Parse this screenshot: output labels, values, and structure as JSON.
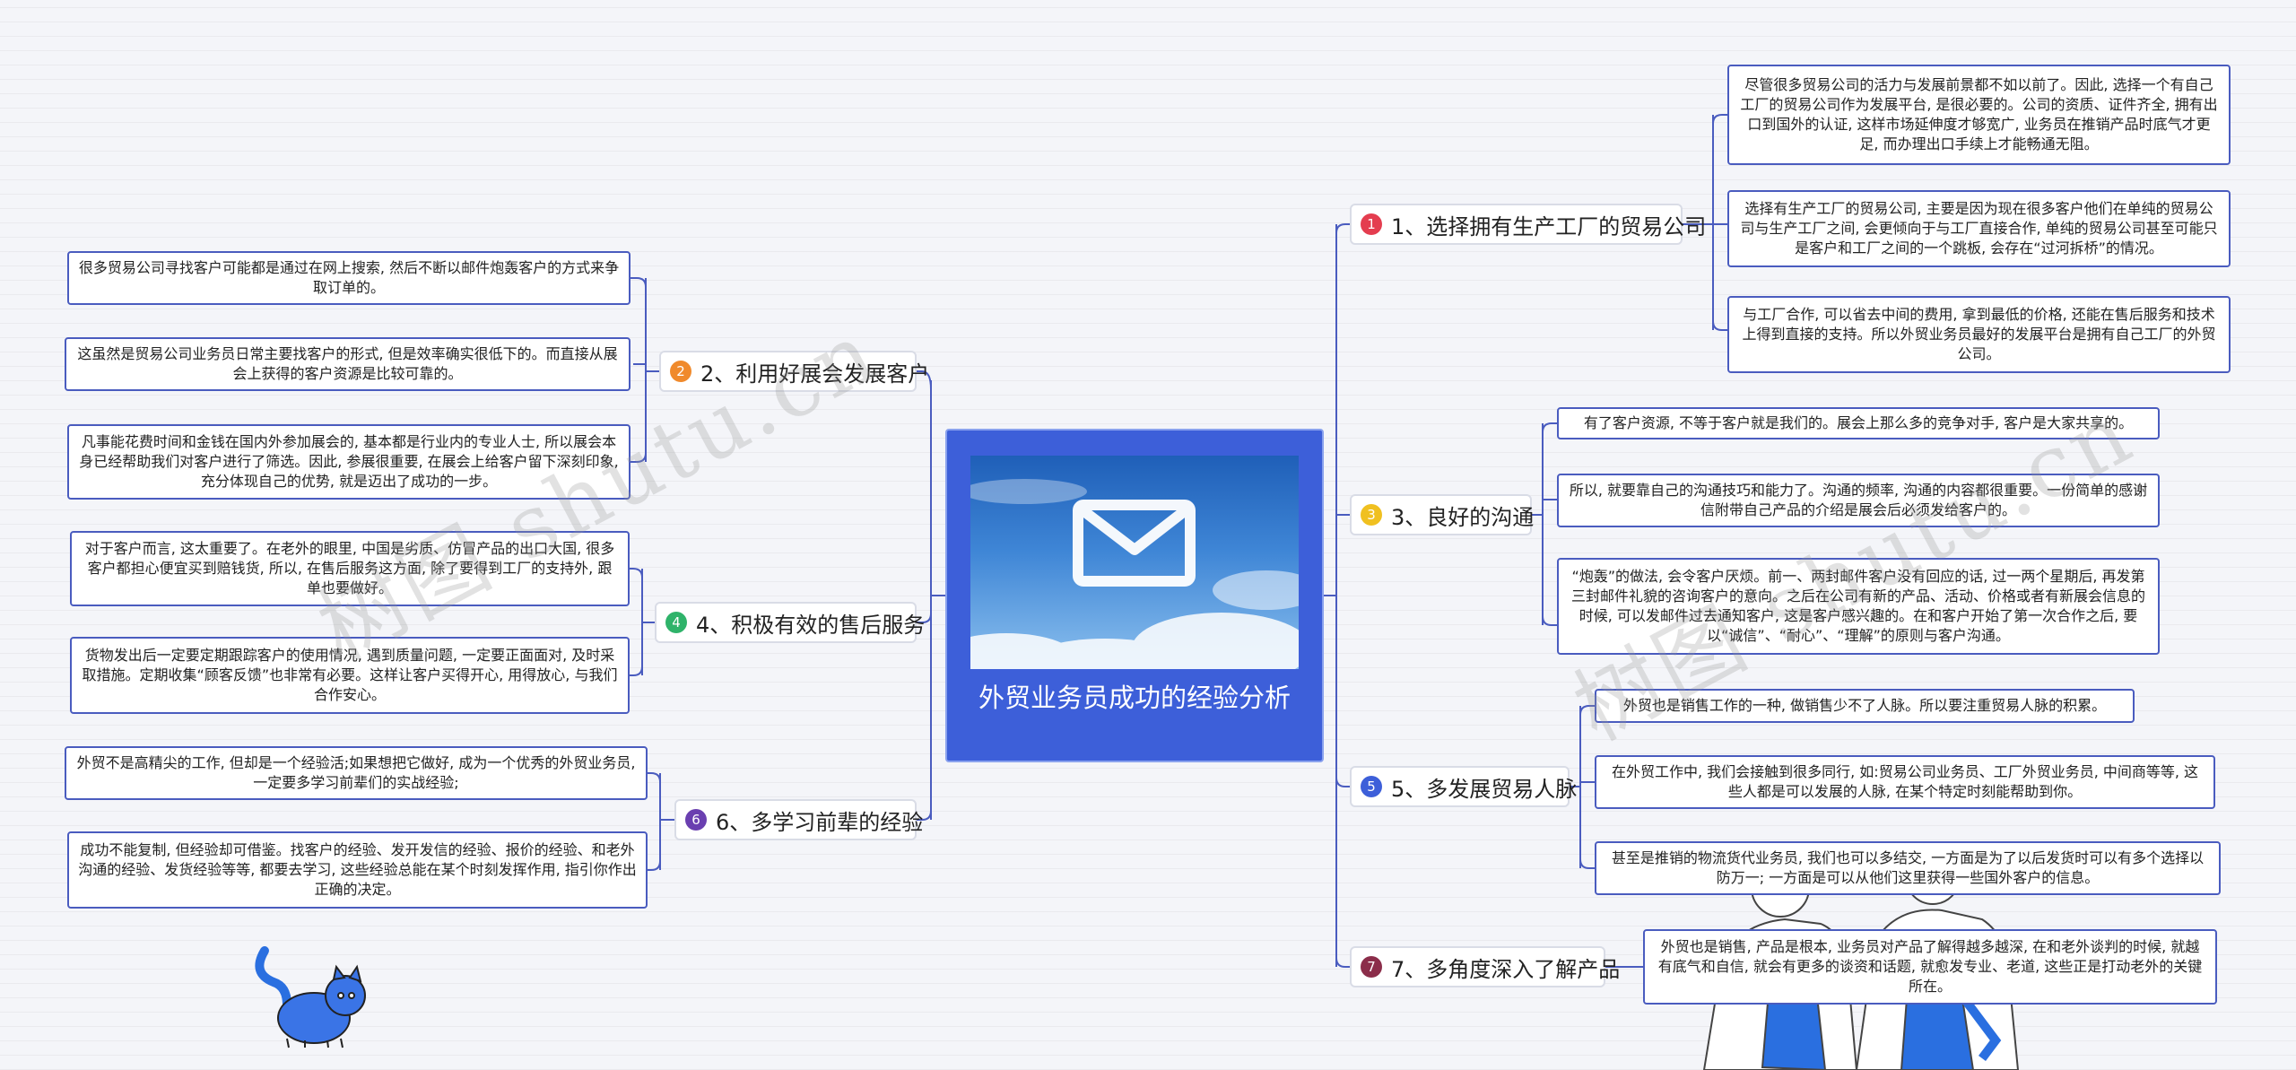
{
  "watermarks": [
    "树图 shutu.cn",
    "树图 shutu.cn"
  ],
  "center": {
    "title": "外贸业务员成功的经验分析",
    "image_icon": "envelope-cloud-icon"
  },
  "colors": {
    "center_bg": "#3d5fd9",
    "leaf_border": "#4a5cbf",
    "line": "#4a5cbf"
  },
  "branches": [
    {
      "badge": "1",
      "color": "#e43d4f",
      "label": "1、选择拥有生产工厂的贸易公司",
      "leaves": [
        "尽管很多贸易公司的活力与发展前景都不如以前了。因此, 选择一个有自己工厂的贸易公司作为发展平台, 是很必要的。公司的资质、证件齐全, 拥有出口到国外的认证, 这样市场延伸度才够宽广, 业务员在推销产品时底气才更足, 而办理出口手续上才能畅通无阻。",
        "选择有生产工厂的贸易公司, 主要是因为现在很多客户他们在单纯的贸易公司与生产工厂之间, 会更倾向于与工厂直接合作, 单纯的贸易公司甚至可能只是客户和工厂之间的一个跳板, 会存在“过河拆桥”的情况。",
        "与工厂合作, 可以省去中间的费用, 拿到最低的价格, 还能在售后服务和技术上得到直接的支持。所以外贸业务员最好的发展平台是拥有自己工厂的外贸公司。"
      ]
    },
    {
      "badge": "2",
      "color": "#f08a2c",
      "label": "2、利用好展会发展客户",
      "leaves": [
        "很多贸易公司寻找客户可能都是通过在网上搜索, 然后不断以邮件炮轰客户的方式来争取订单的。",
        "这虽然是贸易公司业务员日常主要找客户的形式, 但是效率确实很低下的。而直接从展会上获得的客户资源是比较可靠的。",
        "凡事能花费时间和金钱在国内外参加展会的, 基本都是行业内的专业人士, 所以展会本身已经帮助我们对客户进行了筛选。因此, 参展很重要, 在展会上给客户留下深刻印象, 充分体现自己的优势, 就是迈出了成功的一步。"
      ]
    },
    {
      "badge": "3",
      "color": "#f0c020",
      "label": "3、良好的沟通",
      "leaves": [
        "有了客户资源, 不等于客户就是我们的。展会上那么多的竞争对手, 客户是大家共享的。",
        "所以, 就要靠自己的沟通技巧和能力了。沟通的频率, 沟通的内容都很重要。一份简单的感谢信附带自己产品的介绍是展会后必须发给客户的。",
        "“炮轰”的做法, 会令客户厌烦。前一、两封邮件客户没有回应的话, 过一两个星期后, 再发第三封邮件礼貌的咨询客户的意向。之后在公司有新的产品、活动、价格或者有新展会信息的时候, 可以发邮件过去通知客户, 这是客户感兴趣的。在和客户开始了第一次合作之后, 要以“诚信”、“耐心”、“理解”的原则与客户沟通。"
      ]
    },
    {
      "badge": "4",
      "color": "#2fb36a",
      "label": "4、积极有效的售后服务",
      "leaves": [
        "对于客户而言, 这太重要了。在老外的眼里, 中国是劣质、仿冒产品的出口大国, 很多客户都担心便宜买到赔钱货, 所以, 在售后服务这方面, 除了要得到工厂的支持外, 跟单也要做好。",
        "货物发出后一定要定期跟踪客户的使用情况, 遇到质量问题, 一定要正面面对, 及时采取措施。定期收集“顾客反馈”也非常有必要。这样让客户买得开心, 用得放心, 与我们合作安心。"
      ]
    },
    {
      "badge": "5",
      "color": "#3d5fd9",
      "label": "5、多发展贸易人脉",
      "leaves": [
        "外贸也是销售工作的一种, 做销售少不了人脉。所以要注重贸易人脉的积累。",
        "在外贸工作中, 我们会接触到很多同行, 如:贸易公司业务员、工厂外贸业务员, 中间商等等, 这些人都是可以发展的人脉, 在某个特定时刻能帮助到你。",
        "甚至是推销的物流货代业务员, 我们也可以多结交, 一方面是为了以后发货时可以有多个选择以防万一; 一方面是可以从他们这里获得一些国外客户的信息。"
      ]
    },
    {
      "badge": "6",
      "color": "#6a3fb0",
      "label": "6、多学习前辈的经验",
      "leaves": [
        "外贸不是高精尖的工作, 但却是一个经验活;如果想把它做好, 成为一个优秀的外贸业务员, 一定要多学习前辈们的实战经验;",
        "成功不能复制, 但经验却可借鉴。找客户的经验、发开发信的经验、报价的经验、和老外沟通的经验、发货经验等等, 都要去学习, 这些经验总能在某个时刻发挥作用, 指引你作出正确的决定。"
      ]
    },
    {
      "badge": "7",
      "color": "#8b2d4a",
      "label": "7、多角度深入了解产品",
      "leaves": [
        "外贸也是销售, 产品是根本, 业务员对产品了解得越多越深, 在和老外谈判的时候, 就越有底气和自信, 就会有更多的谈资和话题, 就愈发专业、老道, 这些正是打动老外的关键所在。"
      ]
    }
  ]
}
